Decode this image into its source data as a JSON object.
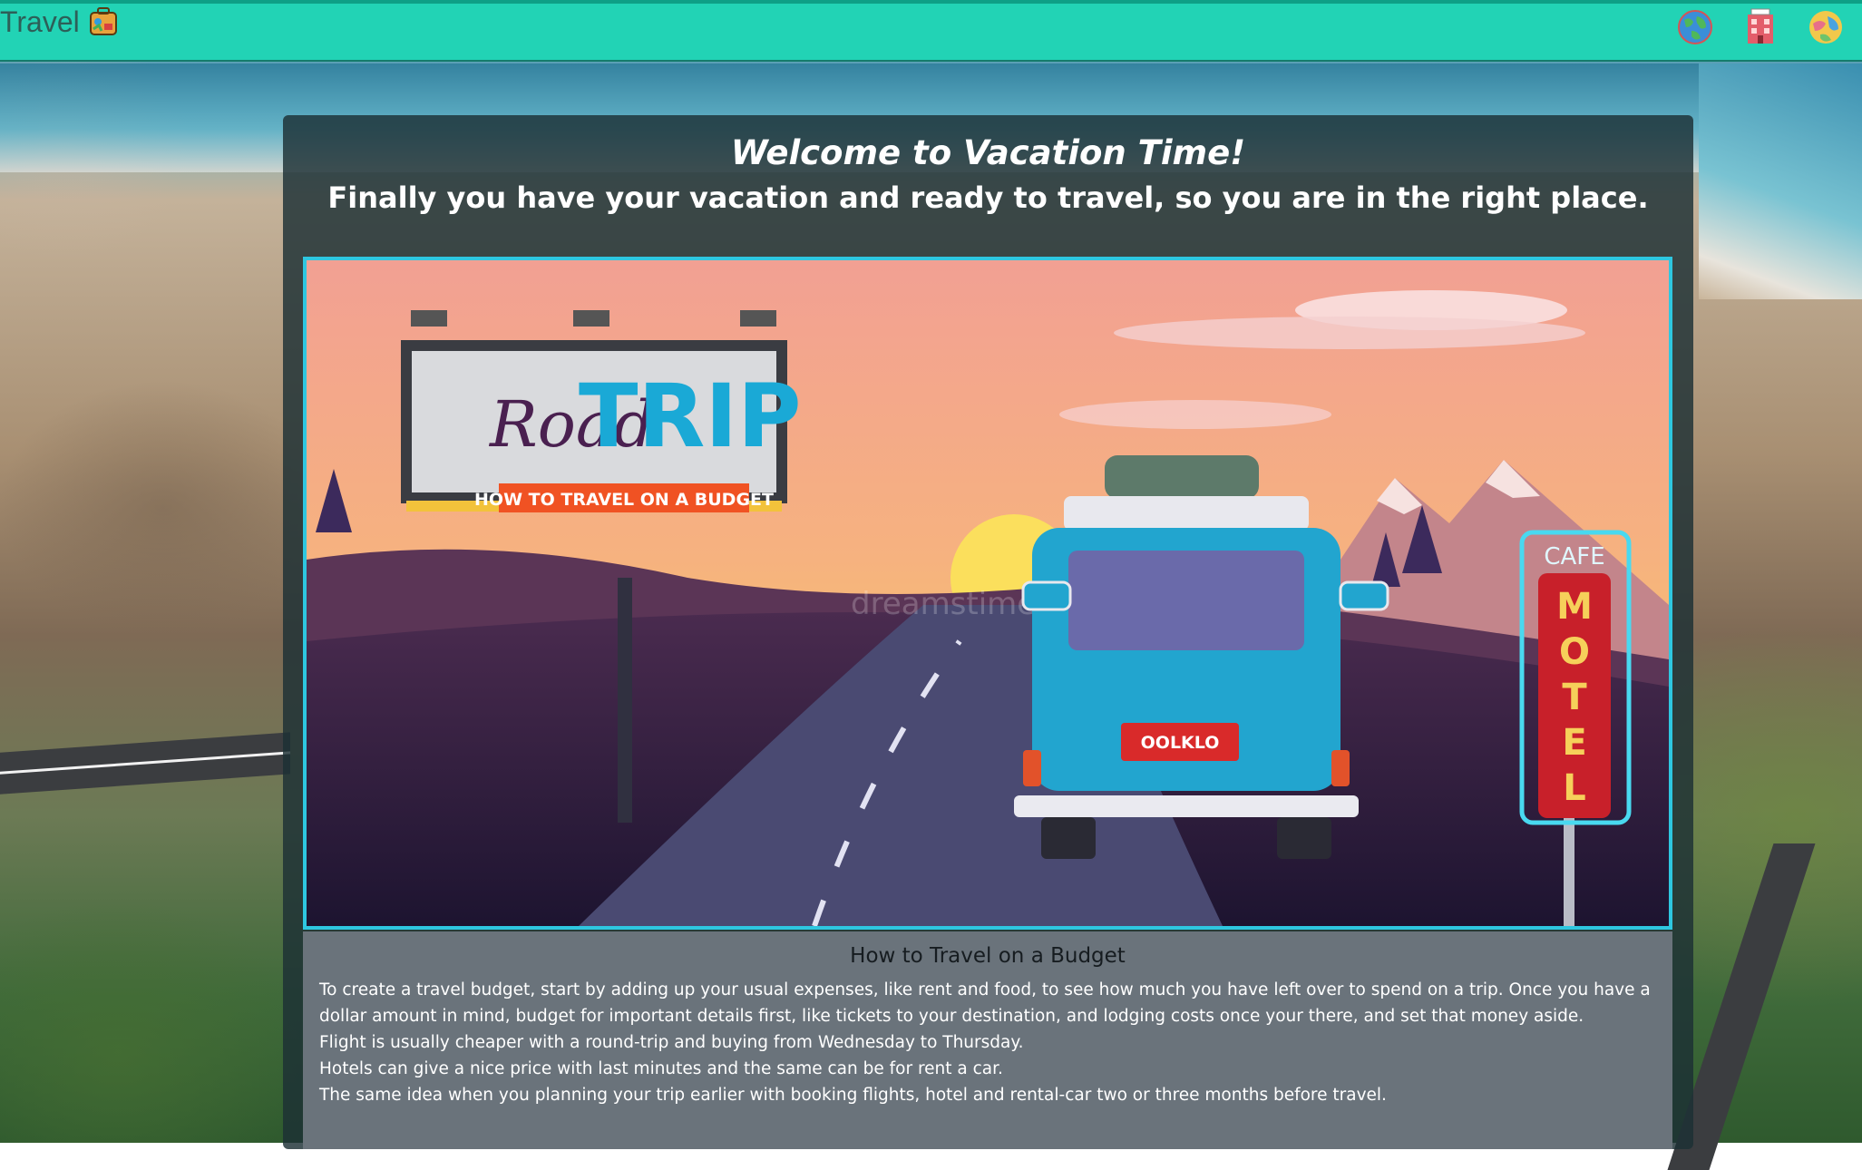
{
  "navbar": {
    "brand": "Travel",
    "brand_icon": "suitcase-icon",
    "icons": [
      "globe-icon",
      "hotel-icon",
      "world-map-icon"
    ]
  },
  "hero": {
    "title": "Welcome to Vacation Time!",
    "subtitle": "Finally you have your vacation and ready to travel, so you are in the right place.",
    "banner": {
      "billboard_script": "Road",
      "billboard_title": "TRIP",
      "billboard_tagline": "HOW TO TRAVEL ON A BUDGET",
      "license_plate": "OOLKLO",
      "sign_top": "CAFE",
      "sign_letters": [
        "M",
        "O",
        "T",
        "E",
        "L"
      ],
      "watermark": "dreamstime"
    }
  },
  "article": {
    "heading": "How to Travel on a Budget",
    "paragraphs": [
      "To create a travel budget, start by adding up your usual expenses, like rent and food, to see how much you have left over to spend on a trip. Once you have a dollar amount in mind, budget for important details first, like tickets to your destination, and lodging costs once your there, and set that money aside.",
      "Flight is usually cheaper with a round-trip and buying from Wednesday to Thursday.",
      "Hotels can give a nice price with last minutes and the same can be for rent a car.",
      "The same idea when you planning your trip earlier with booking flights, hotel and rental-car two or three months before travel."
    ]
  },
  "colors": {
    "navbar": "#22d3b5",
    "panel": "#1c3034",
    "banner_border": "#2ec7e0",
    "article_bg": "#6a737b"
  }
}
